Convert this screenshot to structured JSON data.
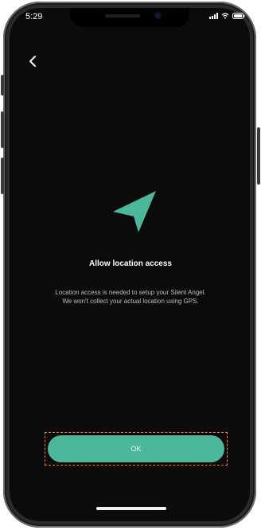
{
  "status_bar": {
    "time": "5:29"
  },
  "nav": {
    "back_icon": "chevron-left-icon"
  },
  "hero": {
    "icon": "navigation-arrow-icon",
    "color": "#4cb79a"
  },
  "title": "Allow location access",
  "description_lines": [
    "Location access is needed to setup your Silent Angel.",
    "We won't collect your actual location using GPS."
  ],
  "primary_button": {
    "label": "OK",
    "color": "#4cb79a"
  }
}
